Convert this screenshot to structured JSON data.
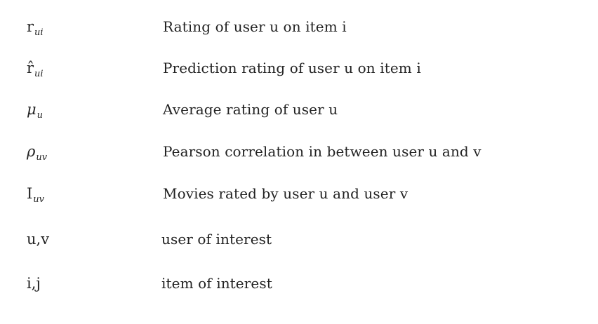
{
  "rows": [
    {
      "symbol": "r",
      "sub": "ui",
      "italic": false,
      "description": "Rating of user u on item i"
    },
    {
      "symbol": "r̂",
      "sub": "ui",
      "italic": false,
      "description": "Prediction rating of user u on item i"
    },
    {
      "symbol": "μ",
      "sub": "u",
      "italic": true,
      "description": "Average rating of user u"
    },
    {
      "symbol": "ρ",
      "sub": "uv",
      "italic": true,
      "description": "Pearson correlation in between user u and v"
    },
    {
      "symbol": "I",
      "sub": "uv",
      "italic": false,
      "description": "Movies rated by user u and user v"
    },
    {
      "symbol": "u,v",
      "sub": "",
      "italic": false,
      "description": "user of interest"
    },
    {
      "symbol": "i,j",
      "sub": "",
      "italic": false,
      "description": "item of interest"
    }
  ]
}
